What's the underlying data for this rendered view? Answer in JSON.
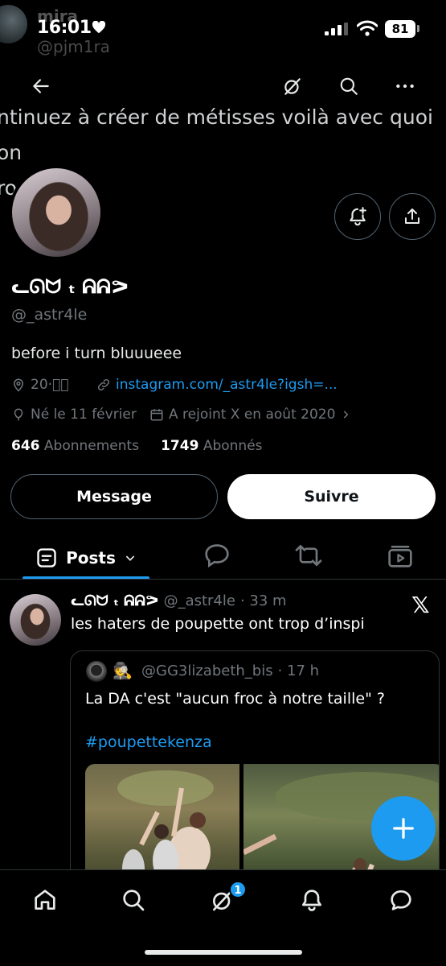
{
  "ghost_header": {
    "name": "mira",
    "handle": "@pjm1ra"
  },
  "status_bar": {
    "time": "16:01",
    "battery": "81"
  },
  "banner": {
    "text": "ntinuez à créer de métisses voilà avec quoi on\nrouve"
  },
  "profile": {
    "display_name": "ᓚᘏᗢ ₜ ᕱᕱᕗ",
    "handle": "@_astr4le",
    "bio": "before i turn bluuueee",
    "location": "20·ৢ͙",
    "link": "instagram.com/_astr4le?igsh=...",
    "birth": "Né le 11 février",
    "joined": "A rejoint X en août 2020",
    "following_count": "646",
    "following_label": "Abonnements",
    "followers_count": "1749",
    "followers_label": "Abonnés"
  },
  "actions": {
    "message": "Message",
    "follow": "Suivre"
  },
  "tabs": {
    "posts": "Posts"
  },
  "post": {
    "name": "ᓚᘏᗢ ₜ ᕱᕱᕗ",
    "handle": "@_astr4le",
    "time": "· 33 m",
    "text": "les haters de poupette ont trop d’inspi",
    "x_logo": "𝕏",
    "quote": {
      "emoji": "🕵",
      "handle": "@GG3lizabeth_bis",
      "time": "· 17 h",
      "text": "La DA c'est \"aucun froc à notre taille\" ?",
      "hashtag": "#poupettekenza"
    }
  },
  "bottom_nav": {
    "grok_badge": "1"
  },
  "colors": {
    "accent": "#1d9bf0",
    "background": "#000000",
    "muted": "#71767b",
    "border": "#2f3336"
  },
  "icons": [
    "back-arrow-icon",
    "grok-icon",
    "search-icon",
    "more-icon",
    "bell-plus-icon",
    "share-icon",
    "location-icon",
    "link-icon",
    "balloon-icon",
    "calendar-icon",
    "chevron-right-icon",
    "posts-icon",
    "chevron-down-icon",
    "reply-icon",
    "repost-icon",
    "media-icon",
    "plus-icon",
    "home-icon",
    "notification-icon",
    "messages-icon"
  ]
}
